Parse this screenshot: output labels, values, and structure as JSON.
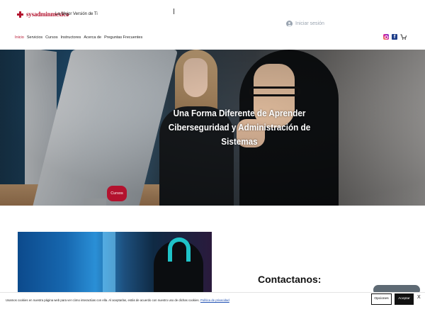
{
  "brand": {
    "logo_text": "sysadminmexico",
    "tagline": "La Mejor Versión de Ti",
    "accent_color": "#b3122e"
  },
  "header": {
    "login_label": "Iniciar sesión",
    "login_icon": "user-avatar-icon",
    "nav": [
      {
        "label": "Inicio",
        "active": true
      },
      {
        "label": "Servicios"
      },
      {
        "label": "Cursos"
      },
      {
        "label": "Instructores"
      },
      {
        "label": "Acerca de"
      },
      {
        "label": "Preguntas Frecuentes"
      }
    ],
    "social_icons": [
      "instagram-icon",
      "facebook-icon",
      "cart-icon"
    ],
    "facebook_glyph": "f"
  },
  "hero": {
    "title_line1": "Una Forma Diferente de Aprender",
    "title_line2": "Ciberseguridad y Administración de Sistemas",
    "button_label": "Cursos"
  },
  "contact": {
    "title": "Contactanos:"
  },
  "cookie_banner": {
    "text": "Usamos cookies en nuestra página web para ver cómo interactúas con ella. Al aceptarlas, estás de acuerdo con nuestro uso de dichas cookies.",
    "link_text": "Política de privacidad",
    "options_label": "Opciones",
    "accept_label": "Aceptar",
    "close_glyph": "X"
  }
}
